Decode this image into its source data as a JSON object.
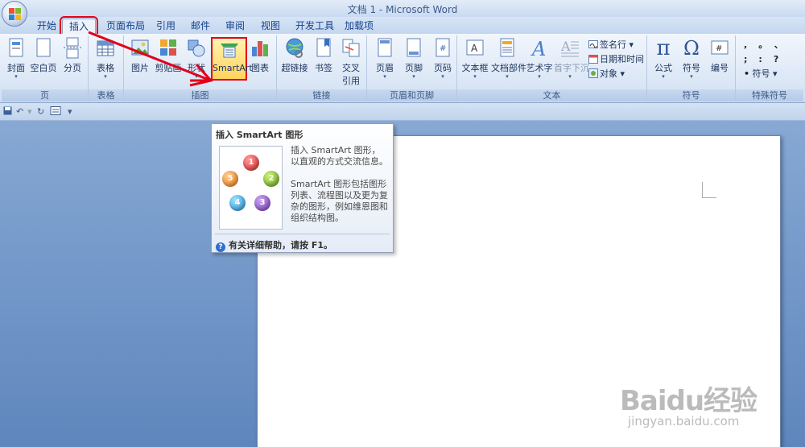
{
  "window": {
    "title": "文档 1 - Microsoft Word"
  },
  "tabs": [
    "开始",
    "插入",
    "页面布局",
    "引用",
    "邮件",
    "审阅",
    "视图",
    "开发工具",
    "加载项"
  ],
  "ribbon": {
    "groups": {
      "page": "页",
      "table": "表格",
      "illustrations": "插图",
      "links": "链接",
      "header_footer": "页眉和页脚",
      "text": "文本",
      "symbols": "符号",
      "special_symbols": "特殊符号"
    },
    "buttons": {
      "cover": "封面",
      "blank_page": "空白页",
      "page_break": "分页",
      "table": "表格",
      "picture": "图片",
      "clip_art": "剪贴画",
      "shapes": "形状",
      "smartart": "SmartArt",
      "chart": "图表",
      "hyperlink": "超链接",
      "bookmark": "书签",
      "cross_ref_1": "交叉",
      "cross_ref_2": "引用",
      "header": "页眉",
      "footer": "页脚",
      "page_number": "页码",
      "text_box": "文本框",
      "doc_parts": "文档部件",
      "wordart": "艺术字",
      "drop_cap": "首字下沉",
      "signature_line": "签名行",
      "date_time": "日期和时间",
      "object": "对象",
      "equation": "公式",
      "symbol": "符号",
      "number": "编号",
      "special_symbol": "符号"
    },
    "special_glyphs": [
      ",",
      "。",
      "、",
      ";",
      ":",
      "?"
    ]
  },
  "tooltip": {
    "title": "插入 SmartArt 图形",
    "desc1": "插入 SmartArt 图形，以直观的方式交流信息。",
    "desc2": "SmartArt 图形包括图形列表、流程图以及更为复杂的图形，例如维恩图和组织结构图。",
    "help": "有关详细帮助，请按 F1。",
    "balls": [
      "1",
      "2",
      "3",
      "4",
      "5"
    ]
  },
  "watermark": {
    "main": "Baidu经验",
    "sub": "jingyan.baidu.com"
  },
  "colors": {
    "highlight": "#e2001a",
    "accent": "#15428b"
  }
}
